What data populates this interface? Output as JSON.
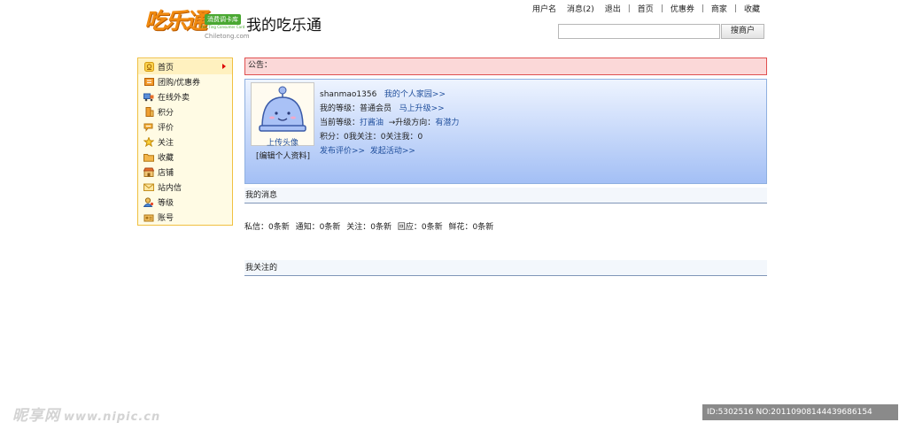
{
  "header": {
    "logo_text": "吃乐通",
    "logo_badge": "消费调卡库",
    "logo_sub": "Fun Ting Consumer Card",
    "logo_url": "Chiletong.com",
    "site_title": "我的吃乐通",
    "topnav": [
      "用户名",
      "消息(2)",
      "退出",
      "首页",
      "优惠券",
      "商家",
      "收藏"
    ],
    "search_placeholder": "",
    "search_button": "搜商户"
  },
  "sidebar": {
    "items": [
      {
        "label": "首页",
        "icon": "home-icon",
        "active": true
      },
      {
        "label": "团购/优惠券",
        "icon": "coupon-icon"
      },
      {
        "label": "在线外卖",
        "icon": "delivery-truck-icon"
      },
      {
        "label": "积分",
        "icon": "points-icon"
      },
      {
        "label": "评价",
        "icon": "review-icon"
      },
      {
        "label": "关注",
        "icon": "follow-star-icon"
      },
      {
        "label": "收藏",
        "icon": "folder-icon"
      },
      {
        "label": "店铺",
        "icon": "shop-icon"
      },
      {
        "label": "站内信",
        "icon": "mail-icon"
      },
      {
        "label": "等级",
        "icon": "user-level-icon"
      },
      {
        "label": "账号",
        "icon": "account-icon"
      }
    ]
  },
  "notice": {
    "label": "公告："
  },
  "profile": {
    "username": "shanmao1356",
    "homepage_link": "我的个人家园>>",
    "level_label": "我的等级：",
    "level_value": "普通会员",
    "upgrade_link": "马上升级>>",
    "current_level_label": "当前等级：",
    "current_level_value": "打酱油",
    "direction_label": "→升级方向：",
    "direction_value": "有潜力",
    "points_line": "积分：0我关注：0关注我：0",
    "post_review_link": "发布评价>>",
    "start_event_link": "发起活动>>",
    "upload_avatar": "上传头像",
    "edit_profile": "[编辑个人资料]"
  },
  "messages": {
    "title": "我的消息",
    "stats": [
      {
        "label": "私信：",
        "value": "0条新"
      },
      {
        "label": "通知：",
        "value": "0条新"
      },
      {
        "label": "关注：",
        "value": "0条新"
      },
      {
        "label": "回应：",
        "value": "0条新"
      },
      {
        "label": "鲜花：",
        "value": "0条新"
      }
    ]
  },
  "following": {
    "title": "我关注的"
  },
  "watermark": {
    "text": "昵享网",
    "url": "www.nipic.cn",
    "id_text": "ID:5302516 NO:20110908144439686154"
  },
  "colors": {
    "notice_bg": "#fbd8d8",
    "notice_border": "#e05050",
    "sidebar_bg": "#fffbe4",
    "sidebar_border": "#f0c040",
    "profile_gradient_top": "#eef4ff",
    "profile_gradient_bottom": "#a3bff5",
    "link": "#1f4e9c",
    "logo_orange": "#f08a10",
    "logo_green": "#4aa832"
  }
}
